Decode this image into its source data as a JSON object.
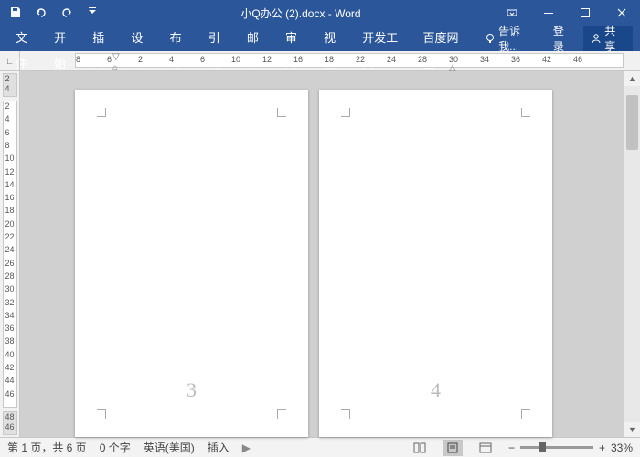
{
  "title": "小Q办公 (2).docx - Word",
  "tabs": [
    "文件",
    "开始",
    "插入",
    "设计",
    "布局",
    "引用",
    "邮件",
    "审阅",
    "视图",
    "开发工具",
    "百度网盘"
  ],
  "tellme": "告诉我...",
  "login": "登录",
  "share": "共享",
  "ruler_h": [
    "8",
    "6",
    "2",
    "4",
    "6",
    "10",
    "12",
    "16",
    "18",
    "22",
    "24",
    "28",
    "30",
    "34",
    "36",
    "42",
    "46"
  ],
  "ruler_v_top": [
    "2",
    "4"
  ],
  "ruler_v": [
    "2",
    "4",
    "6",
    "8",
    "10",
    "12",
    "14",
    "16",
    "18",
    "20",
    "22",
    "24",
    "26",
    "28",
    "30",
    "32",
    "34",
    "36",
    "38",
    "40",
    "42",
    "44",
    "46"
  ],
  "ruler_v_bot": [
    "48",
    "46"
  ],
  "pages": [
    {
      "num": "3"
    },
    {
      "num": "4"
    }
  ],
  "status": {
    "page": "第 1 页，共 6 页",
    "words": "0 个字",
    "lang": "英语(美国)",
    "mode": "插入",
    "zoom": "33%"
  }
}
